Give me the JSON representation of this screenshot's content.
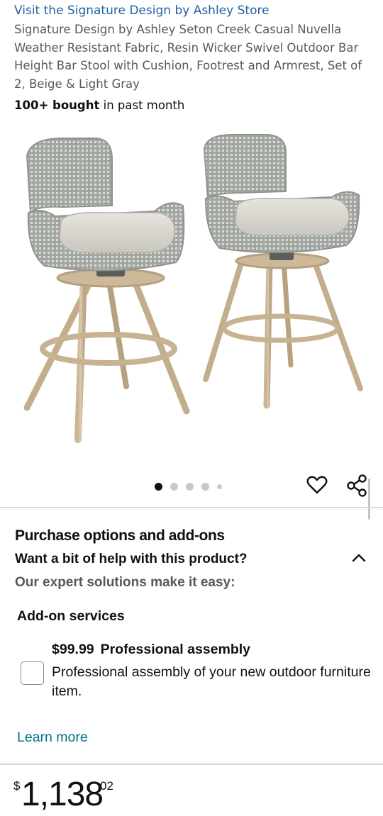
{
  "store_link": "Visit the Signature Design by Ashley Store",
  "product_title": "Signature Design by Ashley Seton Creek Casual Nuvella Weather Resistant Fabric, Resin Wicker Swivel Outdoor Bar Height Bar Stool with Cushion, Footrest and Armrest, Set of 2, Beige & Light Gray",
  "bought": {
    "count": "100+ bought",
    "suffix": " in past month"
  },
  "gallery": {
    "image_count": 5,
    "active_index": 0
  },
  "actions": {
    "wishlist_icon": "heart-icon",
    "share_icon": "share-icon"
  },
  "purchase": {
    "title": "Purchase options and add-ons",
    "help_question": "Want a bit of help with this product?",
    "expert_text": "Our expert solutions make it easy:",
    "expanded": true
  },
  "addon": {
    "heading": "Add-on services",
    "price": "$99.99",
    "name": "Professional assembly",
    "description": "Professional assembly of your new outdoor furniture item.",
    "checked": false
  },
  "learn_more": "Learn more",
  "price": {
    "symbol": "$",
    "whole": "1,138",
    "fraction": "02"
  },
  "colors": {
    "link": "#2162a1",
    "learn_more": "#007185",
    "muted": "#565959",
    "text": "#0f1111",
    "divider": "#d5d9d9"
  }
}
